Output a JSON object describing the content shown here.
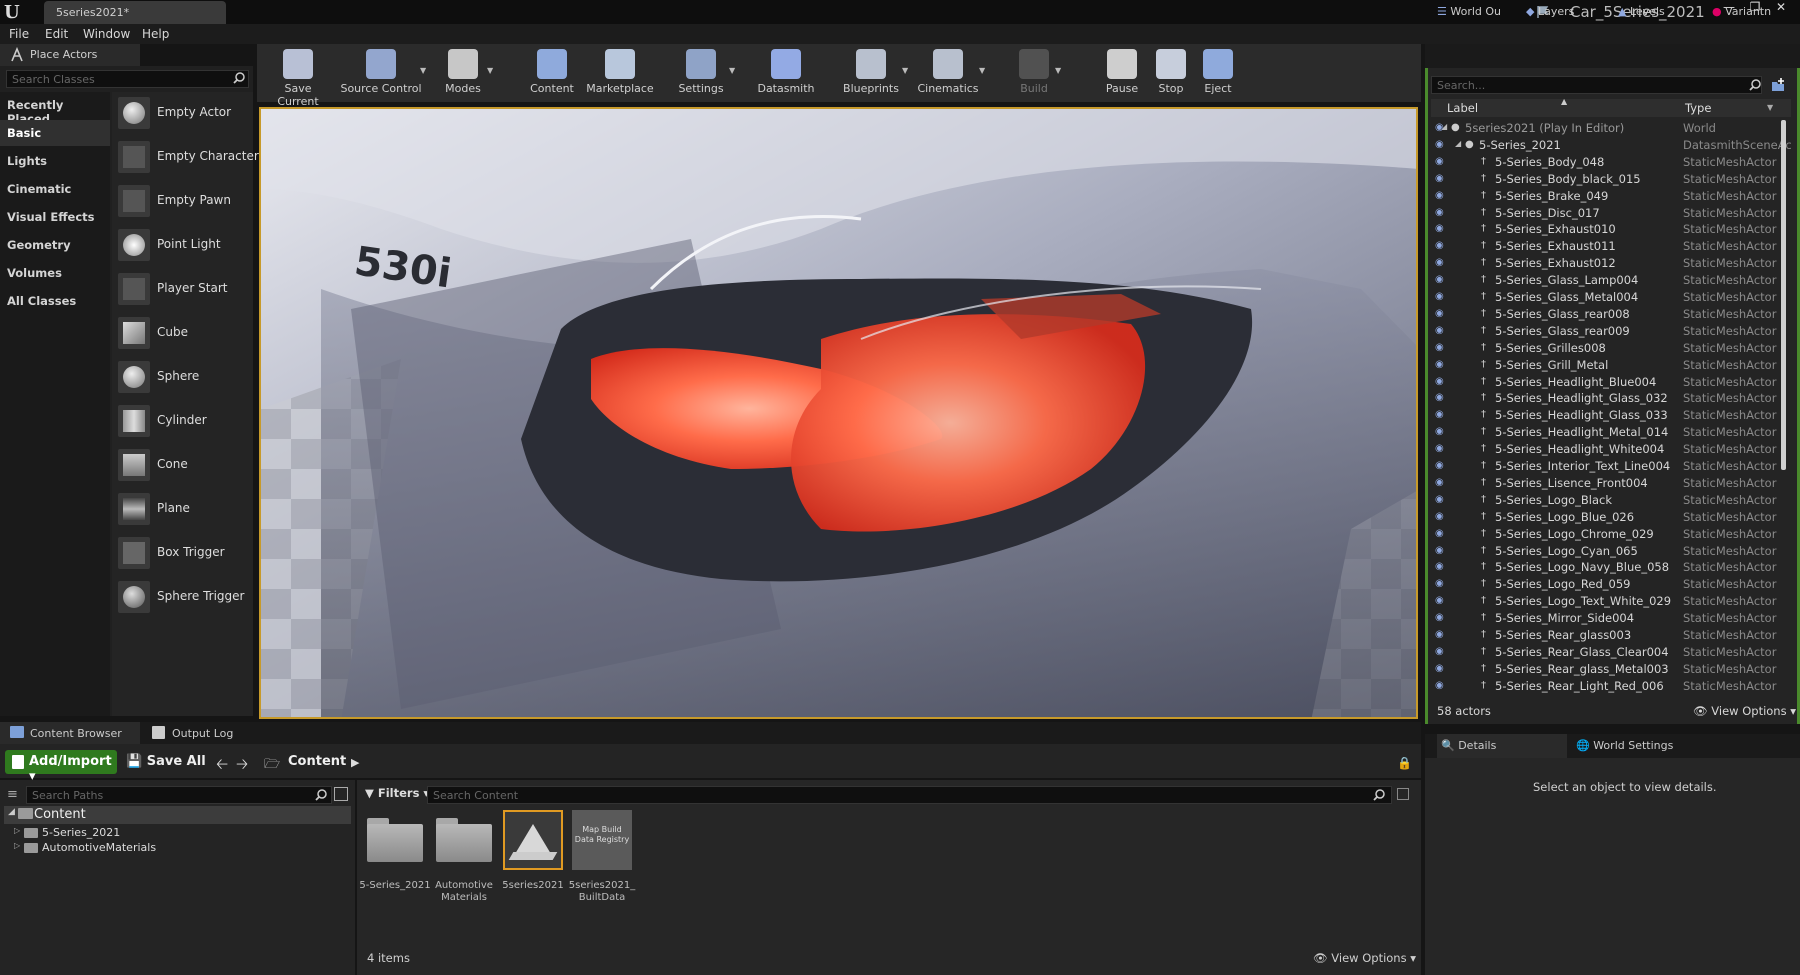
{
  "titlebar": {
    "doc_tab": "5series2021*",
    "project_name": "Car_5Series_2021"
  },
  "menu": [
    "File",
    "Edit",
    "Window",
    "Help"
  ],
  "place_actors": {
    "tab_label": "Place Actors",
    "search_placeholder": "Search Classes",
    "categories": [
      "Recently Placed",
      "Basic",
      "Lights",
      "Cinematic",
      "Visual Effects",
      "Geometry",
      "Volumes",
      "All Classes"
    ],
    "active_category": "Basic",
    "actors": [
      "Empty Actor",
      "Empty Character",
      "Empty Pawn",
      "Point Light",
      "Player Start",
      "Cube",
      "Sphere",
      "Cylinder",
      "Cone",
      "Plane",
      "Box Trigger",
      "Sphere Trigger"
    ]
  },
  "toolbar": {
    "buttons": [
      "Save Current",
      "Source Control",
      "Modes",
      "Content",
      "Marketplace",
      "Settings",
      "Datasmith",
      "Blueprints",
      "Cinematics",
      "Build",
      "Pause",
      "Stop",
      "Eject"
    ]
  },
  "viewport": {
    "badge_text": "530i"
  },
  "outliner": {
    "tabs": [
      "World Ou",
      "Layers",
      "Levels",
      "Variantn"
    ],
    "search_placeholder": "Search...",
    "col_label": "Label",
    "col_type": "Type",
    "rows": [
      {
        "label": "5series2021 (Play In Editor)",
        "type": "World"
      },
      {
        "label": "5-Series_2021",
        "type": "DatasmithSceneAc"
      },
      {
        "label": "5-Series_Body_048",
        "type": "StaticMeshActor"
      },
      {
        "label": "5-Series_Body_black_015",
        "type": "StaticMeshActor"
      },
      {
        "label": "5-Series_Brake_049",
        "type": "StaticMeshActor"
      },
      {
        "label": "5-Series_Disc_017",
        "type": "StaticMeshActor"
      },
      {
        "label": "5-Series_Exhaust010",
        "type": "StaticMeshActor"
      },
      {
        "label": "5-Series_Exhaust011",
        "type": "StaticMeshActor"
      },
      {
        "label": "5-Series_Exhaust012",
        "type": "StaticMeshActor"
      },
      {
        "label": "5-Series_Glass_Lamp004",
        "type": "StaticMeshActor"
      },
      {
        "label": "5-Series_Glass_Metal004",
        "type": "StaticMeshActor"
      },
      {
        "label": "5-Series_Glass_rear008",
        "type": "StaticMeshActor"
      },
      {
        "label": "5-Series_Glass_rear009",
        "type": "StaticMeshActor"
      },
      {
        "label": "5-Series_Grilles008",
        "type": "StaticMeshActor"
      },
      {
        "label": "5-Series_Grill_Metal",
        "type": "StaticMeshActor"
      },
      {
        "label": "5-Series_Headlight_Blue004",
        "type": "StaticMeshActor"
      },
      {
        "label": "5-Series_Headlight_Glass_032",
        "type": "StaticMeshActor"
      },
      {
        "label": "5-Series_Headlight_Glass_033",
        "type": "StaticMeshActor"
      },
      {
        "label": "5-Series_Headlight_Metal_014",
        "type": "StaticMeshActor"
      },
      {
        "label": "5-Series_Headlight_White004",
        "type": "StaticMeshActor"
      },
      {
        "label": "5-Series_Interior_Text_Line004",
        "type": "StaticMeshActor"
      },
      {
        "label": "5-Series_Lisence_Front004",
        "type": "StaticMeshActor"
      },
      {
        "label": "5-Series_Logo_Black",
        "type": "StaticMeshActor"
      },
      {
        "label": "5-Series_Logo_Blue_026",
        "type": "StaticMeshActor"
      },
      {
        "label": "5-Series_Logo_Chrome_029",
        "type": "StaticMeshActor"
      },
      {
        "label": "5-Series_Logo_Cyan_065",
        "type": "StaticMeshActor"
      },
      {
        "label": "5-Series_Logo_Navy_Blue_058",
        "type": "StaticMeshActor"
      },
      {
        "label": "5-Series_Logo_Red_059",
        "type": "StaticMeshActor"
      },
      {
        "label": "5-Series_Logo_Text_White_029",
        "type": "StaticMeshActor"
      },
      {
        "label": "5-Series_Mirror_Side004",
        "type": "StaticMeshActor"
      },
      {
        "label": "5-Series_Rear_glass003",
        "type": "StaticMeshActor"
      },
      {
        "label": "5-Series_Rear_Glass_Clear004",
        "type": "StaticMeshActor"
      },
      {
        "label": "5-Series_Rear_glass_Metal003",
        "type": "StaticMeshActor"
      },
      {
        "label": "5-Series_Rear_Light_Red_006",
        "type": "StaticMeshActor"
      }
    ],
    "actor_count": "58 actors",
    "view_options": "View Options"
  },
  "details": {
    "tabs": [
      "Details",
      "World Settings"
    ],
    "message": "Select an object to view details."
  },
  "content_browser": {
    "tabs": [
      "Content Browser",
      "Output Log"
    ],
    "add_import": "Add/Import",
    "save_all": "Save All",
    "path": "Content",
    "search_paths_placeholder": "Search Paths",
    "filters": "Filters",
    "search_content_placeholder": "Search Content",
    "tree": [
      "Content",
      "5-Series_2021",
      "AutomotiveMaterials"
    ],
    "assets": [
      {
        "label": "5-Series_2021",
        "kind": "folder"
      },
      {
        "label": "Automotive Materials",
        "kind": "folder"
      },
      {
        "label": "5series2021",
        "kind": "level"
      },
      {
        "label": "5series2021_ BuiltData",
        "kind": "builtdata",
        "thumb_text": "Map Build Data Registry"
      }
    ],
    "item_count": "4 items",
    "view_options": "View Options"
  },
  "colors": {
    "accent_green": "#2f7a1e",
    "viewport_border": "#c79a2a",
    "taillight": "#ff5a3c"
  }
}
